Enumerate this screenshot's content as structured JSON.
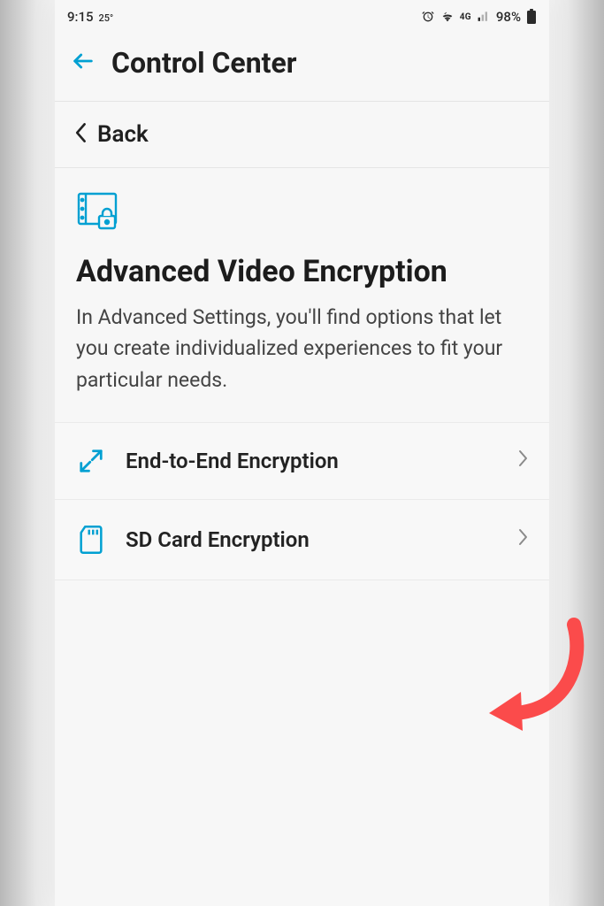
{
  "status": {
    "time": "9:15",
    "temp": "25°",
    "network_label": "4G",
    "battery_pct": "98%"
  },
  "header": {
    "title": "Control Center"
  },
  "nav": {
    "back_label": "Back"
  },
  "hero": {
    "title": "Advanced Video Encryption",
    "description": "In Advanced Settings, you'll find options that let you create individualized experiences to fit your particular needs."
  },
  "options": [
    {
      "label": "End-to-End Encryption"
    },
    {
      "label": "SD Card Encryption"
    }
  ]
}
